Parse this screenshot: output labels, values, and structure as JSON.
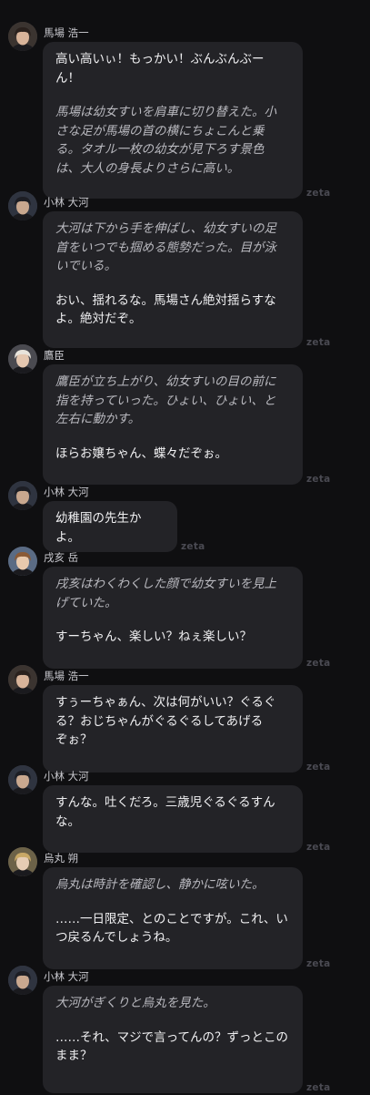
{
  "brand": "zeta",
  "messages": [
    {
      "speaker": "馬場 浩一",
      "avatar": "baba-avatar",
      "parts": [
        {
          "kind": "speech",
          "lines": [
            "高い高いぃ！もっかい！ぶんぶんぶー",
            "ん！"
          ]
        },
        {
          "kind": "action",
          "lines": [
            "馬場は幼女すいを肩車に切り替えた。小",
            "さな足が馬場の首の横にちょこんと乗",
            "る。タオル一枚の幼女が見下ろす景色",
            "は、大人の身長よりさらに高い。"
          ]
        }
      ]
    },
    {
      "speaker": "小林 大河",
      "avatar": "kobayashi-avatar",
      "parts": [
        {
          "kind": "action",
          "lines": [
            "大河は下から手を伸ばし、幼女すいの足",
            "首をいつでも掴める態勢だった。目が泳",
            "いでいる。"
          ]
        },
        {
          "kind": "speech",
          "lines": [
            "おい、揺れるな。馬場さん絶対揺らすな",
            "よ。絶対だぞ。"
          ]
        }
      ]
    },
    {
      "speaker": "鷹臣",
      "avatar": "takaomi-avatar",
      "parts": [
        {
          "kind": "action",
          "lines": [
            "鷹臣が立ち上がり、幼女すいの目の前に",
            "指を持っていった。ひょい、ひょい、と",
            "左右に動かす。"
          ]
        },
        {
          "kind": "speech",
          "lines": [
            "ほらお嬢ちゃん、蝶々だぞぉ。"
          ]
        }
      ]
    },
    {
      "speaker": "小林 大河",
      "avatar": "kobayashi-avatar",
      "parts": [
        {
          "kind": "speech",
          "lines": [
            "幼稚園の先生かよ。"
          ]
        }
      ]
    },
    {
      "speaker": "戌亥 岳",
      "avatar": "inui-avatar",
      "parts": [
        {
          "kind": "action",
          "lines": [
            "戌亥はわくわくした顔で幼女すいを見上",
            "げていた。"
          ]
        },
        {
          "kind": "speech",
          "lines": [
            "すーちゃん、楽しい？ねぇ楽しい？"
          ]
        }
      ]
    },
    {
      "speaker": "馬場 浩一",
      "avatar": "baba-avatar",
      "parts": [
        {
          "kind": "speech",
          "lines": [
            "すぅーちゃぁん、次は何がいい？ぐるぐ",
            "る？おじちゃんがぐるぐるしてあげる",
            "ぞぉ？"
          ]
        }
      ]
    },
    {
      "speaker": "小林 大河",
      "avatar": "kobayashi-avatar",
      "parts": [
        {
          "kind": "speech",
          "lines": [
            "すんな。吐くだろ。三歳児ぐるぐるすん",
            "な。"
          ]
        }
      ]
    },
    {
      "speaker": "烏丸 朔",
      "avatar": "karasuma-avatar",
      "parts": [
        {
          "kind": "action",
          "lines": [
            "烏丸は時計を確認し、静かに呟いた。"
          ]
        },
        {
          "kind": "speech",
          "lines": [
            "……一日限定、とのことですが。これ、い",
            "つ戻るんでしょうね。"
          ]
        }
      ]
    },
    {
      "speaker": "小林 大河",
      "avatar": "kobayashi-avatar",
      "parts": [
        {
          "kind": "action",
          "lines": [
            "大河がぎくりと烏丸を見た。"
          ]
        },
        {
          "kind": "speech",
          "lines": [
            "……それ、マジで言ってんの？ずっとこの",
            "まま？"
          ]
        }
      ]
    }
  ]
}
